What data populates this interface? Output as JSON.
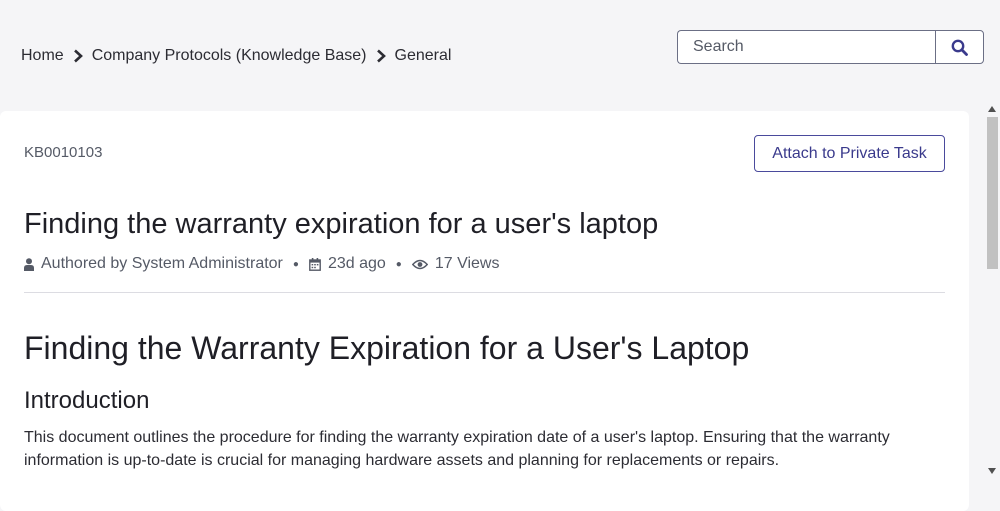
{
  "breadcrumb": {
    "items": [
      "Home",
      "Company Protocols (Knowledge Base)",
      "General"
    ]
  },
  "search": {
    "placeholder": "Search",
    "icon": "search-icon"
  },
  "article": {
    "number": "KB0010103",
    "attach_label": "Attach to Private Task",
    "title": "Finding the warranty expiration for a user's laptop",
    "meta": {
      "author": "Authored by System Administrator",
      "age": "23d ago",
      "views": "17 Views"
    },
    "body": {
      "heading": "Finding the Warranty Expiration for a User's Laptop",
      "section_title": "Introduction",
      "paragraph": "This document outlines the procedure for finding the warranty expiration date of a user's laptop. Ensuring that the warranty information is up-to-date is crucial for managing hardware assets and planning for replacements or repairs."
    }
  },
  "colors": {
    "background": "#f5f5f7",
    "accent": "#3a3a8c",
    "card": "#ffffff"
  }
}
